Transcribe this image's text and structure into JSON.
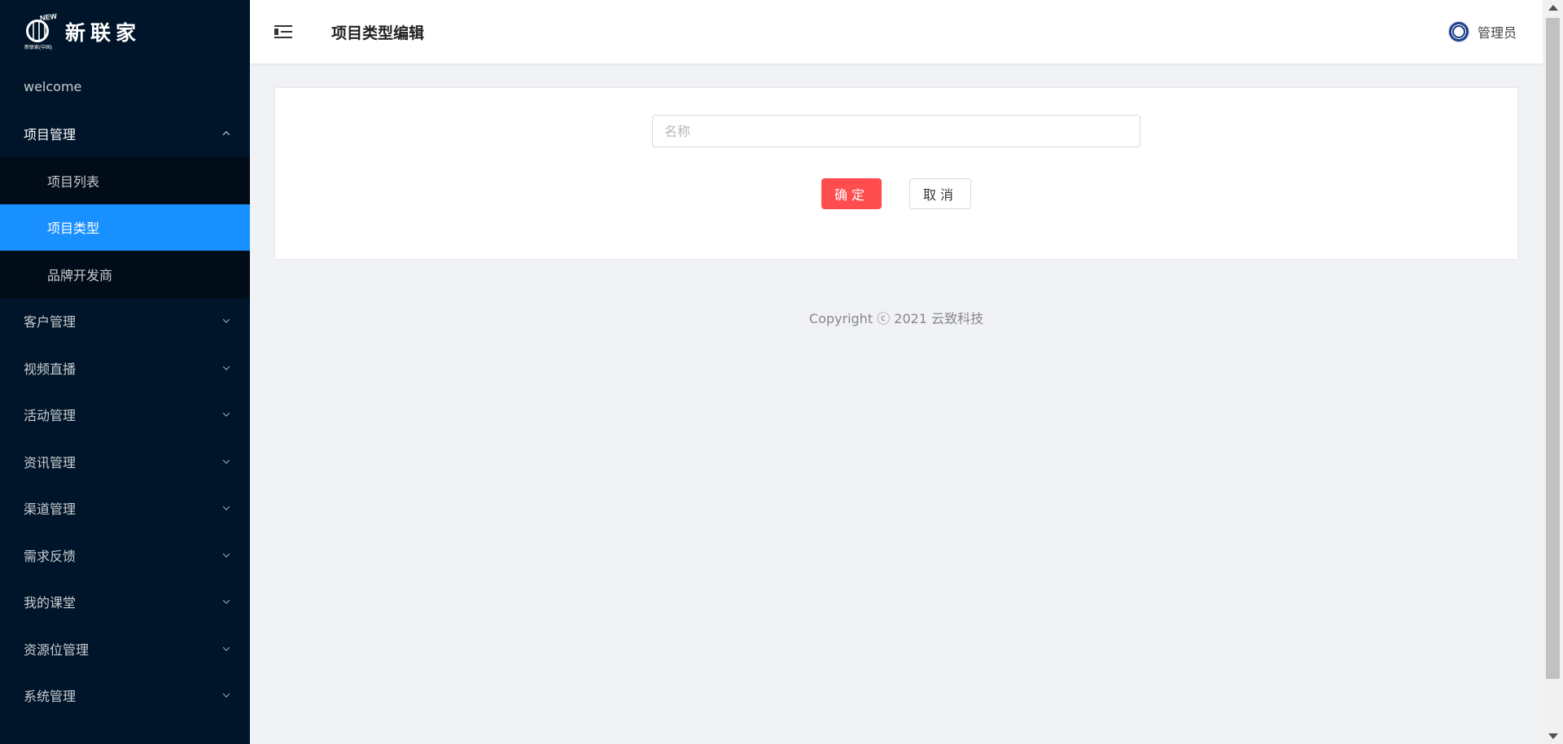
{
  "logo": {
    "mark_text": "NEW",
    "mark_subtext": "新联家(中国)",
    "brand": "新联家"
  },
  "sidebar": {
    "items": [
      {
        "label": "welcome"
      },
      {
        "label": "项目管理",
        "open": true,
        "children": [
          {
            "label": "项目列表"
          },
          {
            "label": "项目类型",
            "active": true
          },
          {
            "label": "品牌开发商"
          }
        ]
      },
      {
        "label": "客户管理"
      },
      {
        "label": "视频直播"
      },
      {
        "label": "活动管理"
      },
      {
        "label": "资讯管理"
      },
      {
        "label": "渠道管理"
      },
      {
        "label": "需求反馈"
      },
      {
        "label": "我的课堂"
      },
      {
        "label": "资源位管理"
      },
      {
        "label": "系统管理"
      }
    ]
  },
  "header": {
    "title": "项目类型编辑",
    "user_name": "管理员"
  },
  "form": {
    "name_placeholder": "名称",
    "name_value": "",
    "confirm_label": "确定",
    "cancel_label": "取消"
  },
  "footer": {
    "copyright": "Copyright ⓒ 2021 云致科技"
  },
  "colors": {
    "sidebar_bg": "#001529",
    "submenu_bg": "#000c17",
    "active": "#1890ff",
    "confirm": "#ff4d4f"
  }
}
